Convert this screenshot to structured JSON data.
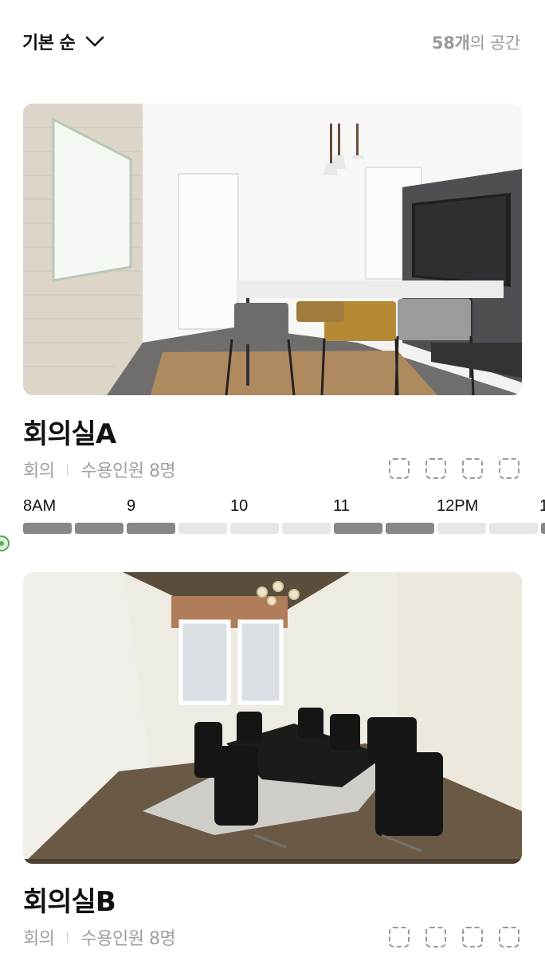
{
  "header": {
    "sort_label": "기본 순",
    "count_number": "58개",
    "count_suffix": "의 공간"
  },
  "rooms": [
    {
      "name": "회의실A",
      "category": "회의",
      "capacity": "수용인원 8명",
      "timeline": {
        "ticks": [
          "8AM",
          "9",
          "10",
          "11",
          "12PM",
          "1"
        ],
        "slots": [
          "booked",
          "booked",
          "booked",
          "free",
          "free",
          "free",
          "booked",
          "booked",
          "free",
          "free",
          "booked"
        ]
      }
    },
    {
      "name": "회의실B",
      "category": "회의",
      "capacity": "수용인원 8명"
    }
  ],
  "colors": {
    "booked": "#878787",
    "free": "#e6e6e6",
    "now_marker": "#5da85d"
  },
  "icons": [
    "chevron-down-icon",
    "amenity-placeholder-icon"
  ]
}
